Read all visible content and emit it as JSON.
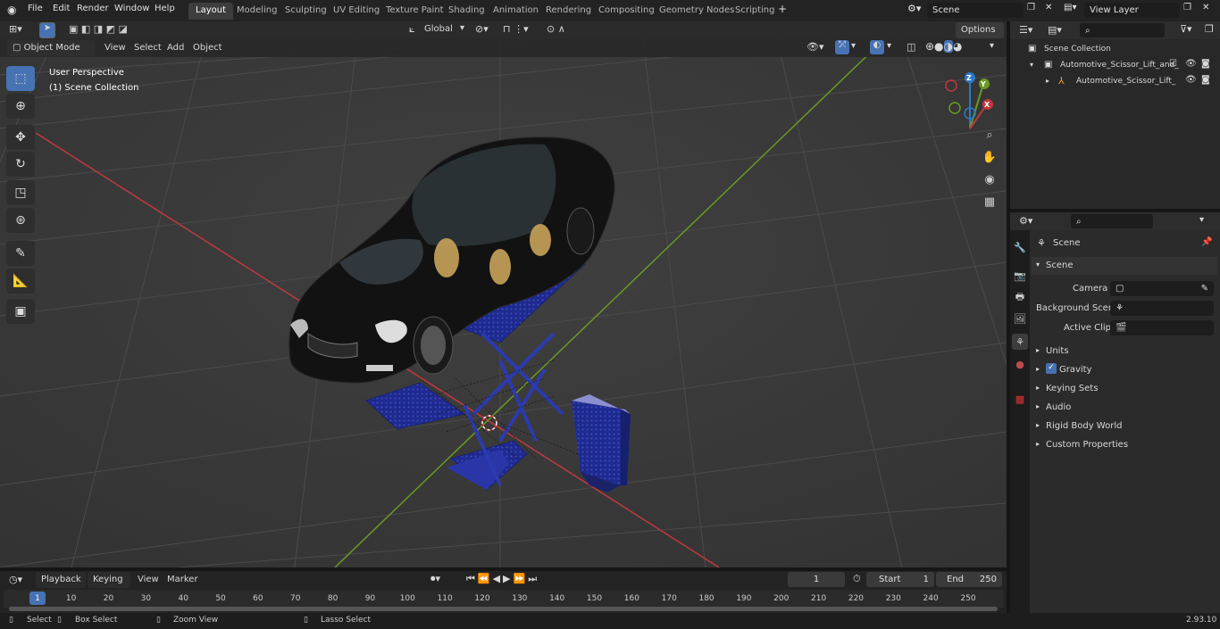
{
  "top_menu": {
    "file": "File",
    "edit": "Edit",
    "render": "Render",
    "window": "Window",
    "help": "Help"
  },
  "workspaces": [
    "Layout",
    "Modeling",
    "Sculpting",
    "UV Editing",
    "Texture Paint",
    "Shading",
    "Animation",
    "Rendering",
    "Compositing",
    "Geometry Nodes",
    "Scripting"
  ],
  "scene_name": "Scene",
  "view_layer": "View Layer",
  "viewport": {
    "mode": "Object Mode",
    "menus": {
      "view": "View",
      "select": "Select",
      "add": "Add",
      "object": "Object"
    },
    "transform_orientation": "Global",
    "options": "Options",
    "overlay_title": "User Perspective",
    "overlay_collection": "(1) Scene Collection",
    "gizmo": {
      "x": "X",
      "y": "Y",
      "z": "Z"
    }
  },
  "outliner": {
    "root": "Scene Collection",
    "items": [
      {
        "label": "Automotive_Scissor_Lift_and_"
      },
      {
        "label": "Automotive_Scissor_Lift_"
      }
    ]
  },
  "properties": {
    "header": "Scene",
    "section": "Scene",
    "fields": {
      "camera": "Camera",
      "background_scene": "Background Scene",
      "active_clip": "Active Clip"
    },
    "panels": [
      "Units",
      "Gravity",
      "Keying Sets",
      "Audio",
      "Rigid Body World",
      "Custom Properties"
    ],
    "gravity_checked": true
  },
  "timeline": {
    "menus": {
      "playback": "Playback",
      "keying": "Keying",
      "view": "View",
      "marker": "Marker"
    },
    "current_frame": "1",
    "start_label": "Start",
    "start": "1",
    "end_label": "End",
    "end": "250",
    "ticks": [
      "1",
      "10",
      "20",
      "30",
      "40",
      "50",
      "60",
      "70",
      "80",
      "90",
      "100",
      "110",
      "120",
      "130",
      "140",
      "150",
      "160",
      "170",
      "180",
      "190",
      "200",
      "210",
      "220",
      "230",
      "240",
      "250"
    ]
  },
  "status": {
    "select": "Select",
    "box_select": "Box Select",
    "zoom_view": "Zoom View",
    "lasso_select": "Lasso Select",
    "version": "2.93.10"
  },
  "colors": {
    "accent": "#4772b3",
    "x_axis": "#c0393f",
    "y_axis": "#6a9a22",
    "z_axis": "#2a79c9",
    "lift": "#1e2a8f"
  }
}
